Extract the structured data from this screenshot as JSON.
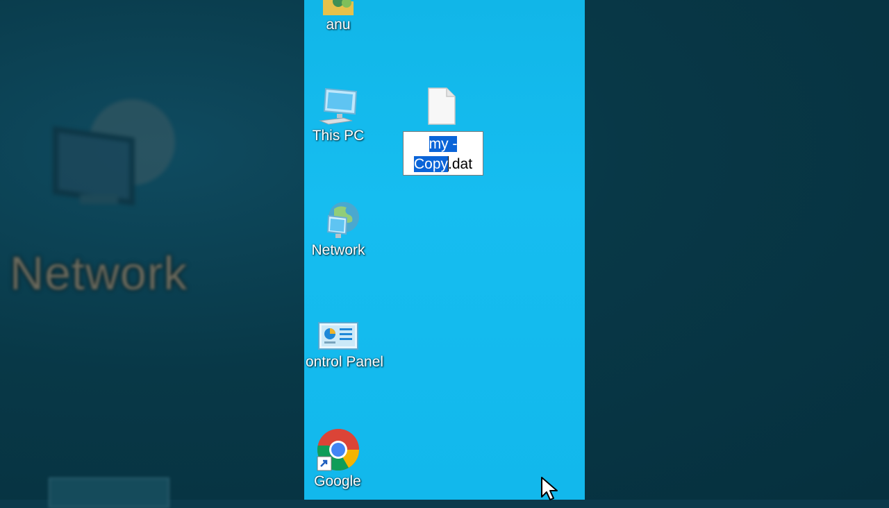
{
  "desktop": {
    "icons": [
      {
        "label": "anu",
        "icon": "user-folder-icon"
      },
      {
        "label": "This PC",
        "icon": "computer-icon"
      },
      {
        "label": "Network",
        "icon": "network-icon"
      },
      {
        "label": "ontrol Panel",
        "icon": "control-panel-icon"
      },
      {
        "label": "Google",
        "icon": "chrome-shortcut-icon"
      }
    ],
    "file": {
      "icon": "blank-file-icon",
      "rename": {
        "selected_line1": "my  -",
        "selected_line2": "Copy",
        "extension": ".dat"
      }
    }
  },
  "background": {
    "blurred_label": "Network"
  },
  "colors": {
    "desktop": "#16bdf0",
    "selection": "#0a64d8",
    "side": "#0b3a4c"
  }
}
